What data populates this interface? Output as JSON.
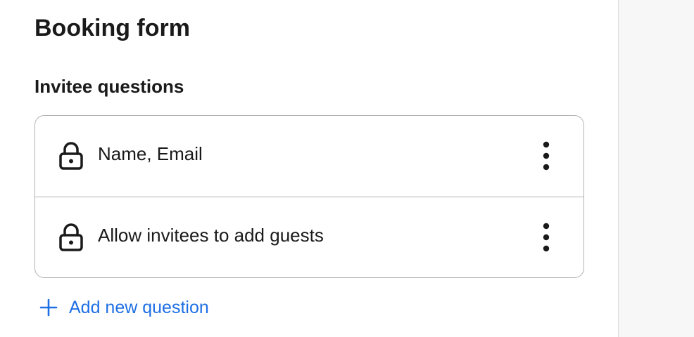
{
  "page": {
    "title": "Booking form"
  },
  "invitee_questions": {
    "heading": "Invitee questions",
    "items": [
      {
        "label": "Name, Email",
        "icon": "lock-icon",
        "locked": true,
        "menu_icon": "more-vertical-icon"
      },
      {
        "label": "Allow invitees to add guests",
        "icon": "lock-icon",
        "locked": true,
        "menu_icon": "more-vertical-icon"
      }
    ],
    "add_button": {
      "label": "Add new question",
      "icon": "plus-icon"
    }
  },
  "colors": {
    "text": "#1a1a1a",
    "accent": "#1f6fe5",
    "border": "#b3b3b3",
    "side_panel": "#f7f7f7"
  }
}
